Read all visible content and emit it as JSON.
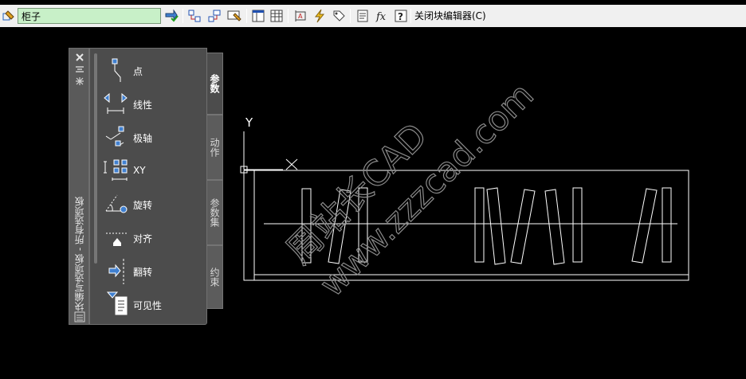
{
  "toolbar": {
    "block_name_value": "柜子",
    "close_editor_label": "关闭块编辑器(C)",
    "icons": [
      "edit-block-icon",
      "save-block-icon",
      "test-block-icon",
      "define-attribute-icon",
      "authoring-palettes-icon",
      "block-table-icon",
      "learn-icon",
      "action-bar-icon",
      "visibility-icon",
      "attribute-icon",
      "fx-icon",
      "help-icon"
    ]
  },
  "palette": {
    "title": "块编写选项板 - 所有选项板",
    "items": [
      {
        "label": "点",
        "icon": "point-parameter-icon"
      },
      {
        "label": "线性",
        "icon": "linear-parameter-icon"
      },
      {
        "label": "极轴",
        "icon": "polar-parameter-icon"
      },
      {
        "label": "XY",
        "icon": "xy-parameter-icon"
      },
      {
        "label": "旋转",
        "icon": "rotation-parameter-icon"
      },
      {
        "label": "对齐",
        "icon": "alignment-parameter-icon"
      },
      {
        "label": "翻转",
        "icon": "flip-parameter-icon"
      },
      {
        "label": "可见性",
        "icon": "visibility-parameter-icon"
      }
    ],
    "tabs": [
      {
        "label": "参数",
        "active": true
      },
      {
        "label": "动作",
        "active": false
      },
      {
        "label": "参数集",
        "active": false
      },
      {
        "label": "约束",
        "active": false
      }
    ]
  },
  "canvas": {
    "ucs_y_label": "Y",
    "watermark_lines": [
      "周站长CAD",
      "www.zzzcad.com"
    ],
    "colors": {
      "background": "#000000",
      "geometry": "#ffffff",
      "block_name_bg": "#c8f0c8"
    }
  }
}
